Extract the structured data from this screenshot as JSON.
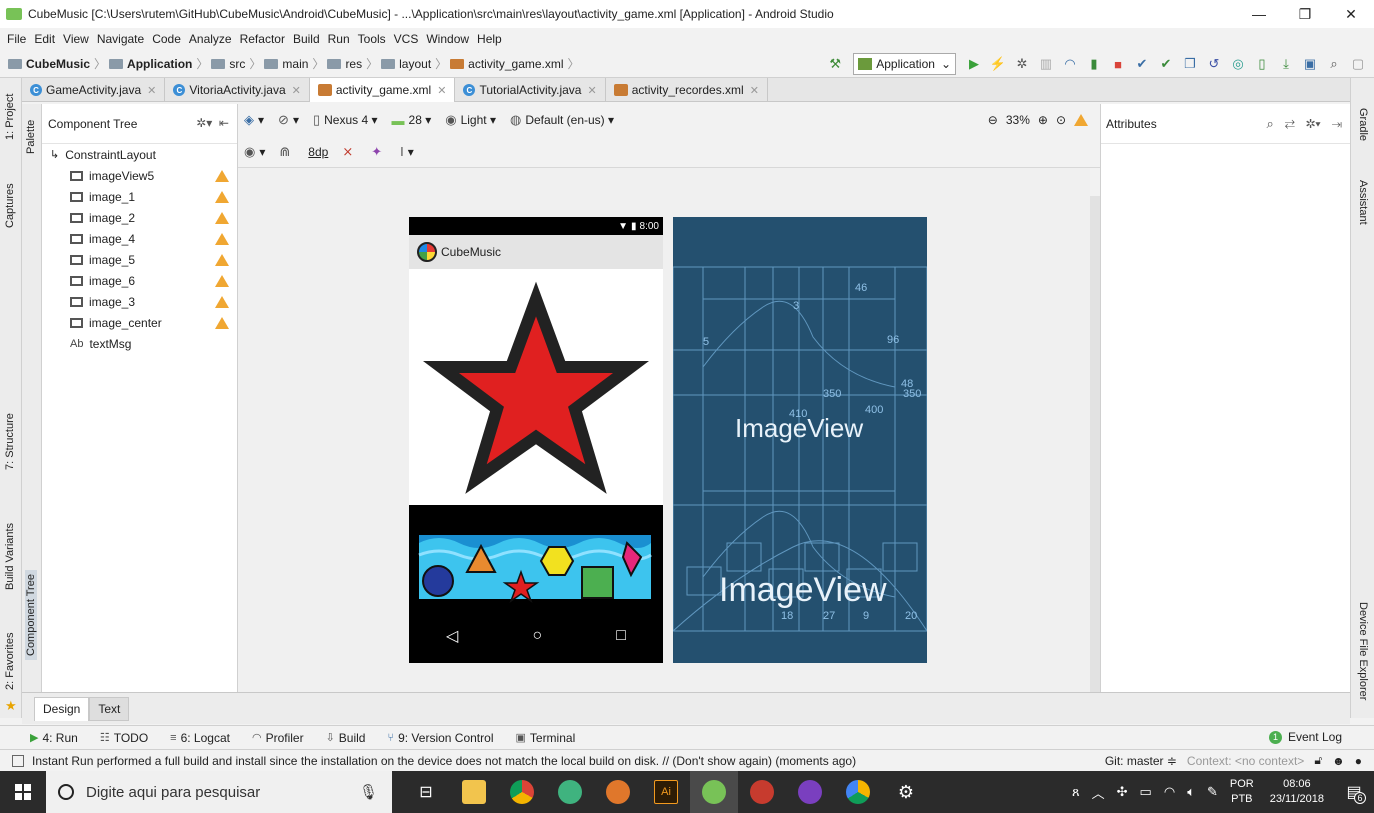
{
  "window": {
    "title": "CubeMusic [C:\\Users\\rutem\\GitHub\\CubeMusic\\Android\\CubeMusic] - ...\\Application\\src\\main\\res\\layout\\activity_game.xml [Application] - Android Studio",
    "minimize": "—",
    "maximize": "❐",
    "close": "✕"
  },
  "menu": [
    "File",
    "Edit",
    "View",
    "Navigate",
    "Code",
    "Analyze",
    "Refactor",
    "Build",
    "Run",
    "Tools",
    "VCS",
    "Window",
    "Help"
  ],
  "breadcrumb": [
    "CubeMusic",
    "Application",
    "src",
    "main",
    "res",
    "layout",
    "activity_game.xml"
  ],
  "run_config": "Application",
  "tabs": [
    {
      "label": "GameActivity.java",
      "kind": "java"
    },
    {
      "label": "VitoriaActivity.java",
      "kind": "java"
    },
    {
      "label": "activity_game.xml",
      "kind": "xml",
      "active": true
    },
    {
      "label": "TutorialActivity.java",
      "kind": "java"
    },
    {
      "label": "activity_recordes.xml",
      "kind": "xml"
    }
  ],
  "left_strip": {
    "project": "1: Project",
    "captures": "Captures",
    "structure": "7: Structure",
    "build_variants": "Build Variants",
    "favorites": "2: Favorites"
  },
  "palette_strip": {
    "palette": "Palette",
    "component_tree": "Component Tree"
  },
  "right_strip": {
    "gradle": "Gradle",
    "assistant": "Assistant",
    "device_file_explorer": "Device File Explorer"
  },
  "component_tree": {
    "title": "Component Tree",
    "root": "ConstraintLayout",
    "items": [
      {
        "label": "imageView5",
        "type": "image",
        "warn": true
      },
      {
        "label": "image_1",
        "type": "image",
        "warn": true
      },
      {
        "label": "image_2",
        "type": "image",
        "warn": true
      },
      {
        "label": "image_4",
        "type": "image",
        "warn": true
      },
      {
        "label": "image_5",
        "type": "image",
        "warn": true
      },
      {
        "label": "image_6",
        "type": "image",
        "warn": true
      },
      {
        "label": "image_3",
        "type": "image",
        "warn": true
      },
      {
        "label": "image_center",
        "type": "image",
        "warn": true
      },
      {
        "label": "textMsg",
        "type": "text",
        "warn": false
      }
    ]
  },
  "design_toolbar": {
    "device": "Nexus 4",
    "api": "28",
    "theme": "Light",
    "locale": "Default (en-us)",
    "zoom": "33%",
    "margin": "8dp"
  },
  "preview": {
    "status_time": "8:00",
    "app_title": "CubeMusic",
    "blueprint_label_1": "ImageView",
    "blueprint_label_2": "ImageView"
  },
  "attributes": {
    "title": "Attributes"
  },
  "bottom_tabs": [
    "Design",
    "Text"
  ],
  "tool_windows": [
    {
      "label": "4: Run",
      "icon": "run-icon"
    },
    {
      "label": "TODO",
      "icon": "todo-icon"
    },
    {
      "label": "6: Logcat",
      "icon": "logcat-icon"
    },
    {
      "label": "Profiler",
      "icon": "profiler-icon"
    },
    {
      "label": "Build",
      "icon": "build-icon"
    },
    {
      "label": "9: Version Control",
      "icon": "vcs-icon"
    },
    {
      "label": "Terminal",
      "icon": "terminal-icon"
    }
  ],
  "event_log": {
    "label": "Event Log",
    "count": "1"
  },
  "status": {
    "message": "Instant Run performed a full build and install since the installation on the device does not match the local build on disk. // (Don't show again) (moments ago)",
    "git": "Git: master ≑",
    "context": "Context: <no context>"
  },
  "taskbar": {
    "search_placeholder": "Digite aqui para pesquisar",
    "lang_top": "POR",
    "lang_bottom": "PTB",
    "time": "08:06",
    "date": "23/11/2018",
    "notifications": "6"
  }
}
